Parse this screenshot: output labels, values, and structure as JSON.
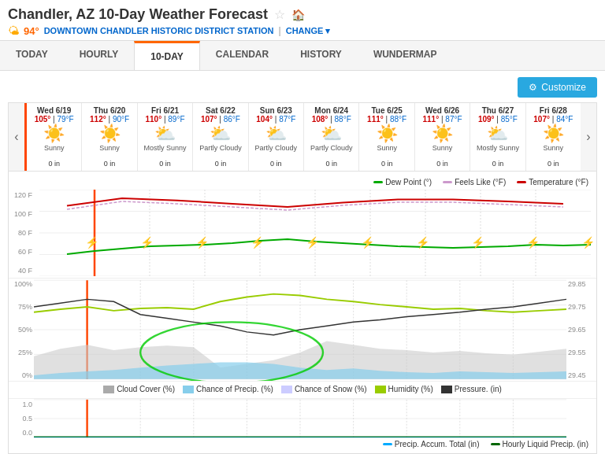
{
  "header": {
    "title": "Chandler, AZ 10-Day Weather Forecast",
    "temp": "94°",
    "station": "DOWNTOWN CHANDLER HISTORIC DISTRICT STATION",
    "change": "CHANGE"
  },
  "nav": {
    "tabs": [
      "TODAY",
      "HOURLY",
      "10-DAY",
      "CALENDAR",
      "HISTORY",
      "WUNDERMAP"
    ],
    "active": "10-DAY"
  },
  "toolbar": {
    "customize": "Customize"
  },
  "forecast": {
    "days": [
      {
        "date": "Wed 6/19",
        "high": "105°",
        "low": "79°F",
        "icon": "☀️",
        "desc": "Sunny",
        "precip": "0 in",
        "today": true
      },
      {
        "date": "Thu 6/20",
        "high": "112°",
        "low": "90°F",
        "icon": "☀️",
        "desc": "Sunny",
        "precip": "0 in",
        "today": false
      },
      {
        "date": "Fri 6/21",
        "high": "110°",
        "low": "89°F",
        "icon": "⛅",
        "desc": "Mostly Sunny",
        "precip": "0 in",
        "today": false
      },
      {
        "date": "Sat 6/22",
        "high": "107°",
        "low": "86°F",
        "icon": "⛅",
        "desc": "Partly Cloudy",
        "precip": "0 in",
        "today": false
      },
      {
        "date": "Sun 6/23",
        "high": "104°",
        "low": "87°F",
        "icon": "⛅",
        "desc": "Partly Cloudy",
        "precip": "0 in",
        "today": false
      },
      {
        "date": "Mon 6/24",
        "high": "108°",
        "low": "88°F",
        "icon": "⛅",
        "desc": "Partly Cloudy",
        "precip": "0 in",
        "today": false
      },
      {
        "date": "Tue 6/25",
        "high": "111°",
        "low": "88°F",
        "icon": "☀️",
        "desc": "Sunny",
        "precip": "0 in",
        "today": false
      },
      {
        "date": "Wed 6/26",
        "high": "111°",
        "low": "87°F",
        "icon": "☀️",
        "desc": "Sunny",
        "precip": "0 in",
        "today": false
      },
      {
        "date": "Thu 6/27",
        "high": "109°",
        "low": "85°F",
        "icon": "⛅",
        "desc": "Mostly Sunny",
        "precip": "0 in",
        "today": false
      },
      {
        "date": "Fri 6/28",
        "high": "107°",
        "low": "84°F",
        "icon": "☀️",
        "desc": "Sunny",
        "precip": "0 in",
        "today": false
      }
    ]
  },
  "legend": {
    "dew_point": "Dew Point (°)",
    "feels_like": "Feels Like (°F)",
    "temperature": "Temperature (°F)"
  },
  "chart_yaxis": {
    "temp": [
      "120 F",
      "100 F",
      "80 F",
      "60 F",
      "40 F"
    ],
    "percent": [
      "100%",
      "75%",
      "50%",
      "25%",
      "0%"
    ],
    "pressure": [
      "29.85",
      "29.75",
      "29.65",
      "29.55",
      "29.45"
    ],
    "precip_y": [
      "1.0",
      "0.5",
      "0.0"
    ]
  },
  "bottom_legend": {
    "items": [
      {
        "label": "Cloud Cover (%)",
        "color": "#aaaaaa"
      },
      {
        "label": "Chance of Precip. (%)",
        "color": "#87ceeb"
      },
      {
        "label": "Chance of Snow (%)",
        "color": "#ccccff"
      },
      {
        "label": "Humidity (%)",
        "color": "#99cc00"
      },
      {
        "label": "Pressure. (in)",
        "color": "#333333"
      }
    ]
  },
  "bottom_chart_legend": {
    "items": [
      {
        "label": "Precip. Accum. Total (in)",
        "color": "#00aaff"
      },
      {
        "label": "Hourly Liquid Precip. (in)",
        "color": "#006600"
      }
    ]
  }
}
